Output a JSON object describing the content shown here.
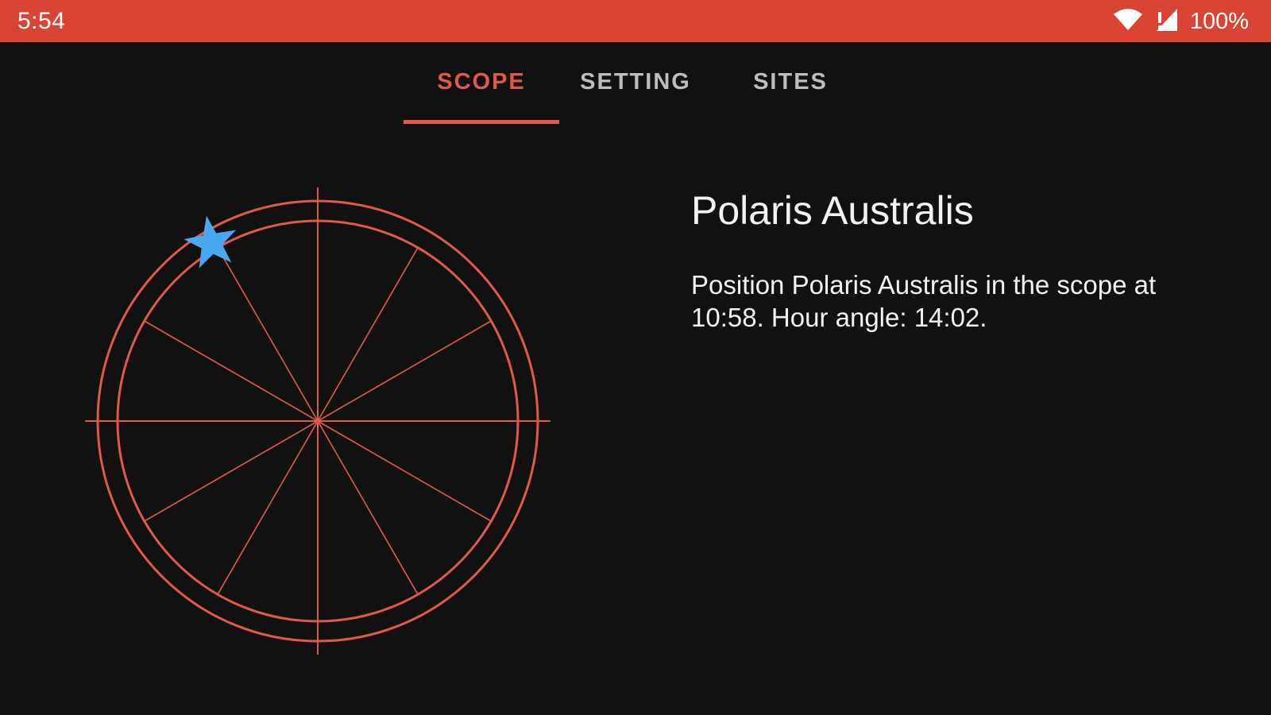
{
  "status_bar": {
    "time": "5:54",
    "battery": "100%",
    "icons": [
      "wifi-icon",
      "cellular-signal-icon"
    ],
    "background_color": "#d94434"
  },
  "tabs": [
    {
      "label": "SCOPE",
      "active": true
    },
    {
      "label": "SETTING",
      "active": false
    },
    {
      "label": "SITES",
      "active": false
    }
  ],
  "accent_color": "#e05a4a",
  "scope": {
    "reticle_color": "#e05a4a",
    "star_color": "#4aa8f0",
    "star_icon": "star-icon",
    "hour_angle": "14:02"
  },
  "target": {
    "title": "Polaris Australis",
    "message": "Position Polaris Australis in the scope at 10:58. Hour angle: 14:02."
  }
}
